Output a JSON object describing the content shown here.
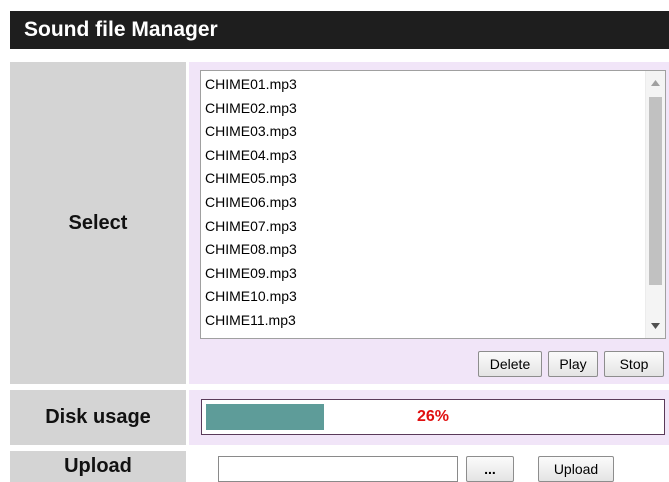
{
  "title": "Sound file Manager",
  "select": {
    "label": "Select",
    "files": [
      "CHIME01.mp3",
      "CHIME02.mp3",
      "CHIME03.mp3",
      "CHIME04.mp3",
      "CHIME05.mp3",
      "CHIME06.mp3",
      "CHIME07.mp3",
      "CHIME08.mp3",
      "CHIME09.mp3",
      "CHIME10.mp3",
      "CHIME11.mp3"
    ],
    "buttons": {
      "delete": "Delete",
      "play": "Play",
      "stop": "Stop"
    }
  },
  "disk": {
    "label": "Disk usage",
    "percent_text": "26%",
    "fill_fraction": 0.26,
    "fill_color": "#5e9c99",
    "percent_color": "#e01010"
  },
  "upload": {
    "label": "Upload",
    "browse_label": "...",
    "upload_button": "Upload",
    "file_value": ""
  }
}
